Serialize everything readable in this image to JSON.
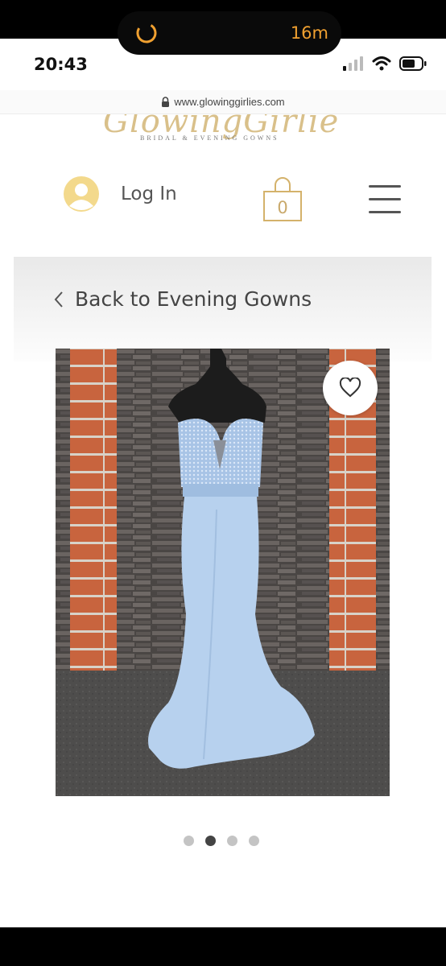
{
  "status_bar": {
    "time": "20:43"
  },
  "recording": {
    "timer": "16m",
    "accent": "#f0a030"
  },
  "browser": {
    "url": "www.glowinggirlies.com"
  },
  "logo": {
    "script": "GlowingGirlies",
    "subtitle": "BRIDAL & EVENING GOWNS"
  },
  "header": {
    "login_label": "Log In",
    "cart_count": "0",
    "accent": "#c9a96b"
  },
  "navigation": {
    "back_label": "Back to Evening Gowns"
  },
  "gallery": {
    "total": 4,
    "active_index": 1
  }
}
